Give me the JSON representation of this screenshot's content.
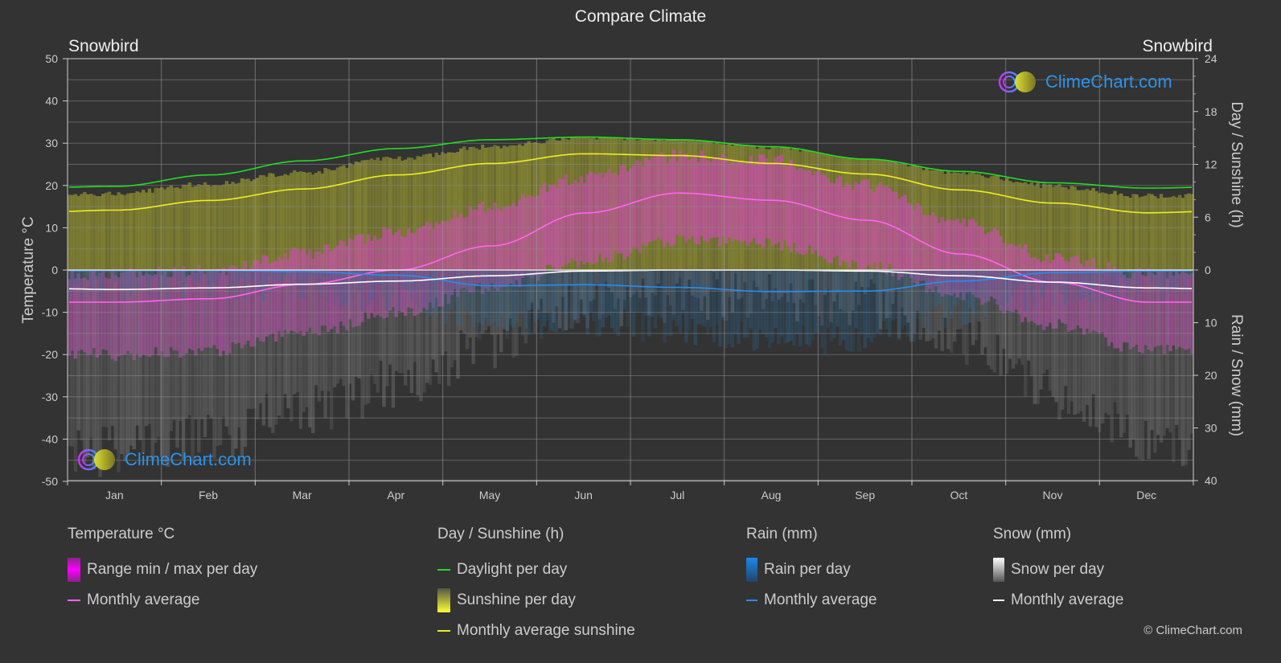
{
  "title": "Compare Climate",
  "location_left": "Snowbird",
  "location_right": "Snowbird",
  "logo_text": "ClimeChart.com",
  "copyright": "© ClimeChart.com",
  "colors": {
    "background": "#333333",
    "temp_avg": "#ff66ee",
    "temp_range": "#cc33cc",
    "daylight": "#22dd22",
    "sunshine_avg": "#eeee22",
    "sunshine_fill": "#8a8a33",
    "rain_avg": "#2a8cec",
    "rain_fill": "#2a6b9c",
    "snow_avg": "#ffffff",
    "snow_fill": "#777777",
    "logo_text": "#2a93ea"
  },
  "legend": {
    "temperature": {
      "heading": "Temperature °C",
      "items": [
        "Range min / max per day",
        "Monthly average"
      ]
    },
    "sunshine": {
      "heading": "Day / Sunshine (h)",
      "items": [
        "Daylight per day",
        "Sunshine per day",
        "Monthly average sunshine"
      ]
    },
    "rain": {
      "heading": "Rain (mm)",
      "items": [
        "Rain per day",
        "Monthly average"
      ]
    },
    "snow": {
      "heading": "Snow (mm)",
      "items": [
        "Snow per day",
        "Monthly average"
      ]
    }
  },
  "chart_data": {
    "type": "line",
    "title": "Compare Climate",
    "categories": [
      "Jan",
      "Feb",
      "Mar",
      "Apr",
      "May",
      "Jun",
      "Jul",
      "Aug",
      "Sep",
      "Oct",
      "Nov",
      "Dec"
    ],
    "axes": {
      "left": {
        "label": "Temperature °C",
        "range": [
          -50,
          50
        ],
        "ticks": [
          50,
          40,
          30,
          20,
          10,
          0,
          -10,
          -20,
          -30,
          -40,
          -50
        ]
      },
      "right_top": {
        "label": "Day / Sunshine (h)",
        "range": [
          0,
          24
        ],
        "ticks": [
          24,
          18,
          12,
          6,
          0
        ]
      },
      "right_bottom": {
        "label": "Rain / Snow (mm)",
        "range": [
          0,
          40
        ],
        "ticks": [
          0,
          10,
          20,
          30,
          40
        ]
      }
    },
    "grid": true,
    "series": [
      {
        "name": "Temperature monthly average",
        "axis": "left",
        "unit": "°C",
        "values": [
          -7.6,
          -6.8,
          -3.4,
          0.0,
          5.7,
          13.5,
          18.2,
          16.5,
          11.8,
          3.8,
          -2.9,
          -7.6
        ]
      },
      {
        "name": "Daylight per day",
        "axis": "right_top",
        "unit": "h",
        "values": [
          9.5,
          10.8,
          12.4,
          13.8,
          14.8,
          15.1,
          14.8,
          14.0,
          12.6,
          11.2,
          9.9,
          9.3
        ]
      },
      {
        "name": "Monthly average sunshine",
        "axis": "right_top",
        "unit": "h",
        "values": [
          6.8,
          7.9,
          9.2,
          10.8,
          12.1,
          13.2,
          13.0,
          12.1,
          10.9,
          9.1,
          7.6,
          6.5
        ]
      },
      {
        "name": "Rain monthly average",
        "axis": "right_bottom",
        "unit": "mm",
        "values": [
          0.1,
          0.1,
          0.3,
          1.0,
          3.0,
          2.8,
          3.3,
          4.1,
          4.0,
          2.1,
          0.5,
          0.2
        ]
      },
      {
        "name": "Snow monthly average",
        "axis": "right_bottom",
        "unit": "mm",
        "values": [
          3.7,
          3.4,
          2.7,
          2.1,
          1.1,
          0.2,
          0.0,
          0.0,
          0.2,
          1.1,
          2.3,
          3.4
        ]
      }
    ],
    "temp_range_approx": {
      "min": [
        -20,
        -19,
        -15,
        -10,
        -4,
        2,
        7,
        6,
        1,
        -6,
        -13,
        -19
      ],
      "max": [
        -1,
        0,
        4,
        9,
        15,
        22,
        27,
        26,
        20,
        11,
        3,
        -1
      ]
    },
    "legend_position": "bottom"
  }
}
